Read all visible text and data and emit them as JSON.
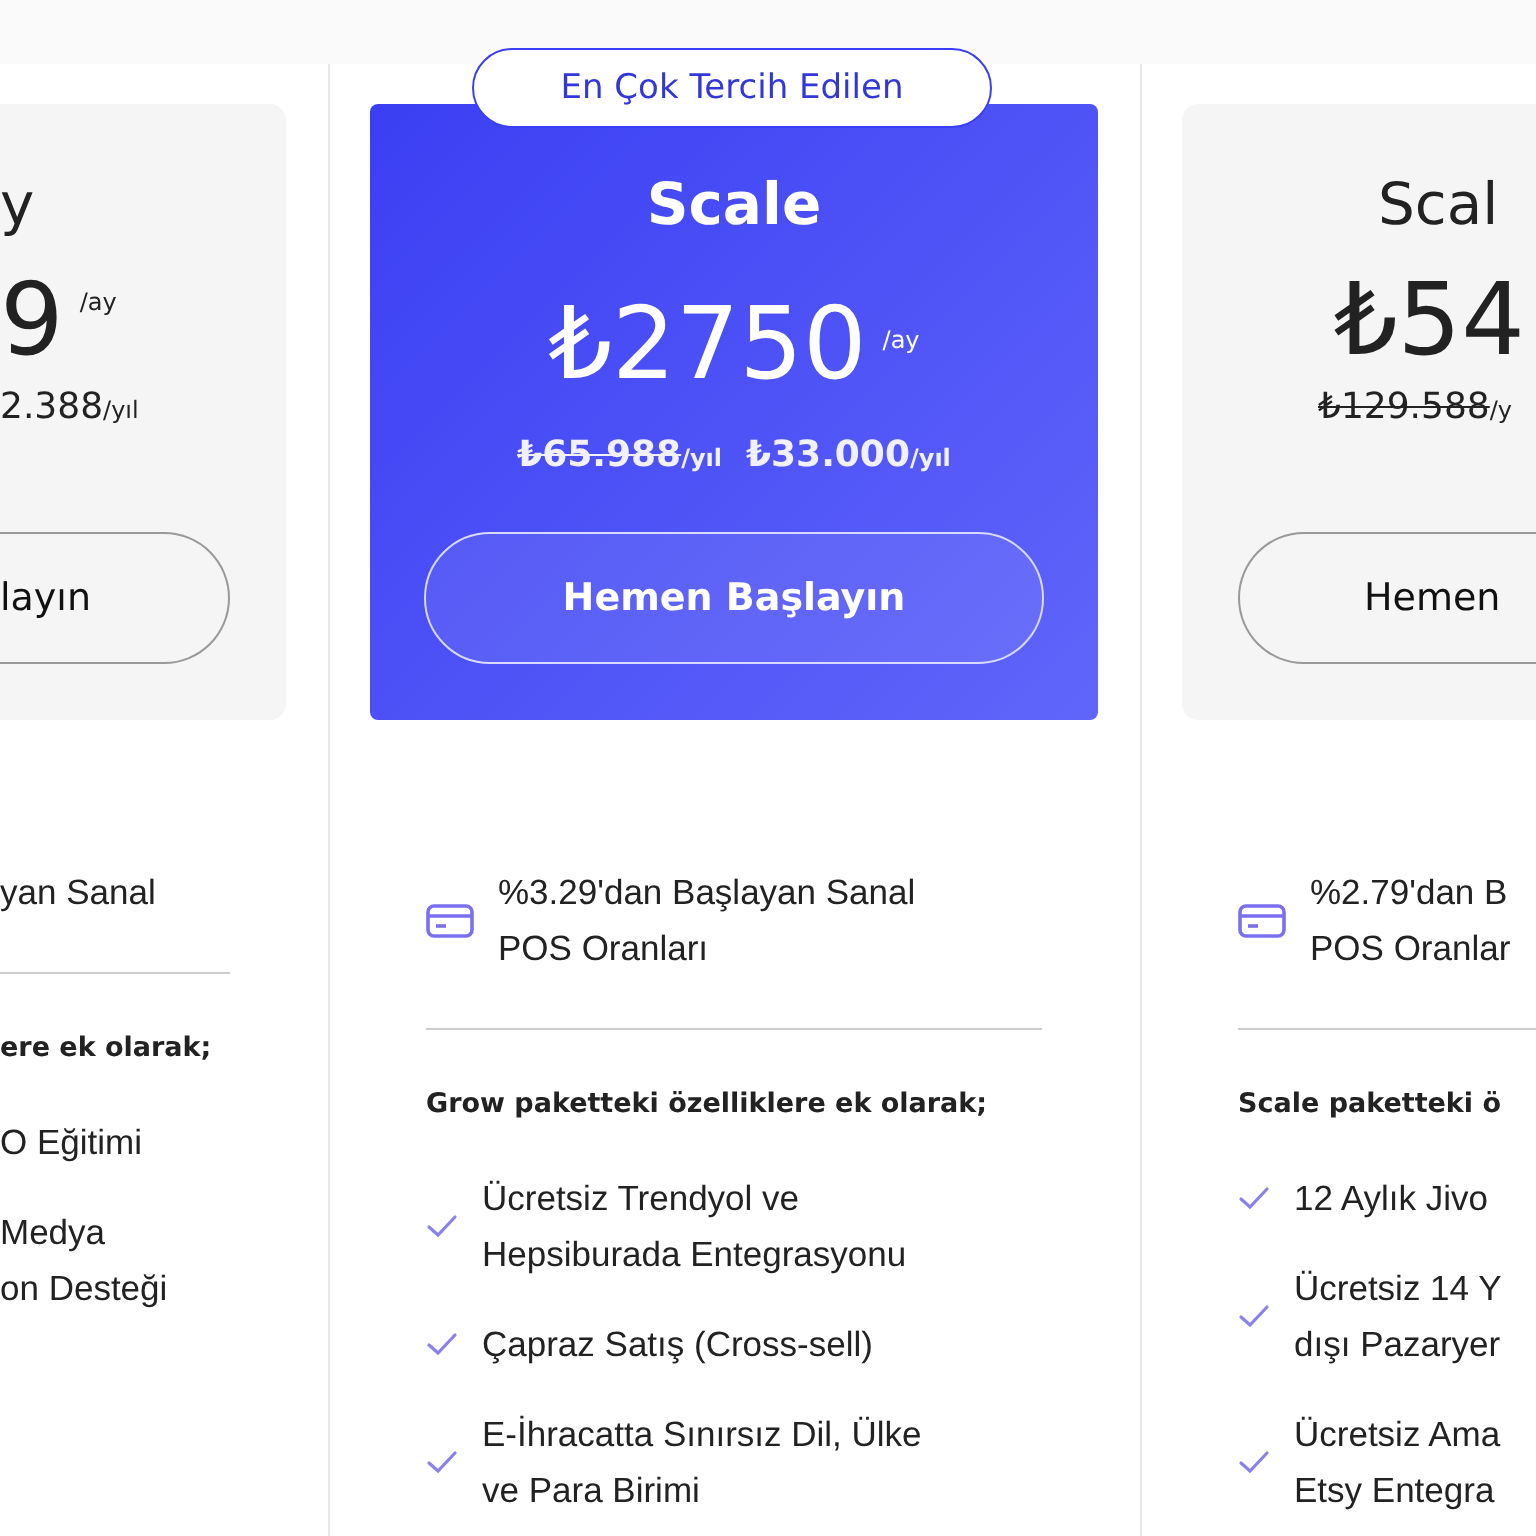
{
  "badge": "En Çok Tercih Edilen",
  "plans": [
    {
      "kind": "cut-left",
      "featured": false,
      "name": "y",
      "price": "9",
      "price_unit": "/ay",
      "yearly": [
        {
          "amount": "2.388",
          "unit": "/yıl",
          "struck": false
        }
      ],
      "button": "layın",
      "pos": [
        "yan Sanal"
      ],
      "intro": "ere ek olarak;",
      "features": [
        [
          "O Eğitimi"
        ],
        [
          "Medya",
          "on Desteği"
        ]
      ]
    },
    {
      "kind": "full",
      "featured": true,
      "name": "Scale",
      "price": "₺2750",
      "price_unit": "/ay",
      "yearly": [
        {
          "amount": "₺65.988",
          "unit": "/yıl",
          "struck": true
        },
        {
          "amount": "₺33.000",
          "unit": "/yıl",
          "struck": false
        }
      ],
      "button": "Hemen Başlayın",
      "pos": [
        "%3.29'dan Başlayan Sanal",
        "POS Oranları"
      ],
      "intro": "Grow paketteki özelliklere ek olarak;",
      "features": [
        [
          "Ücretsiz Trendyol ve",
          "Hepsiburada Entegrasyonu"
        ],
        [
          "Çapraz Satış (Cross-sell)"
        ],
        [
          "E-İhracatta Sınırsız Dil, Ülke",
          "ve Para Birimi"
        ]
      ]
    },
    {
      "kind": "cut-right",
      "featured": false,
      "name": "Scal",
      "price": "₺54",
      "yearly": [
        {
          "amount": "₺129.588",
          "unit": "/y",
          "struck": true
        }
      ],
      "button": "Hemen",
      "pos": [
        "%2.79'dan B",
        "POS Oranlar"
      ],
      "intro": "Scale paketteki ö",
      "features": [
        [
          "12 Aylık Jivo"
        ],
        [
          "Ücretsiz 14 Y",
          "dışı Pazaryer"
        ],
        [
          "Ücretsiz Ama",
          "Etsy Entegra"
        ]
      ]
    }
  ]
}
